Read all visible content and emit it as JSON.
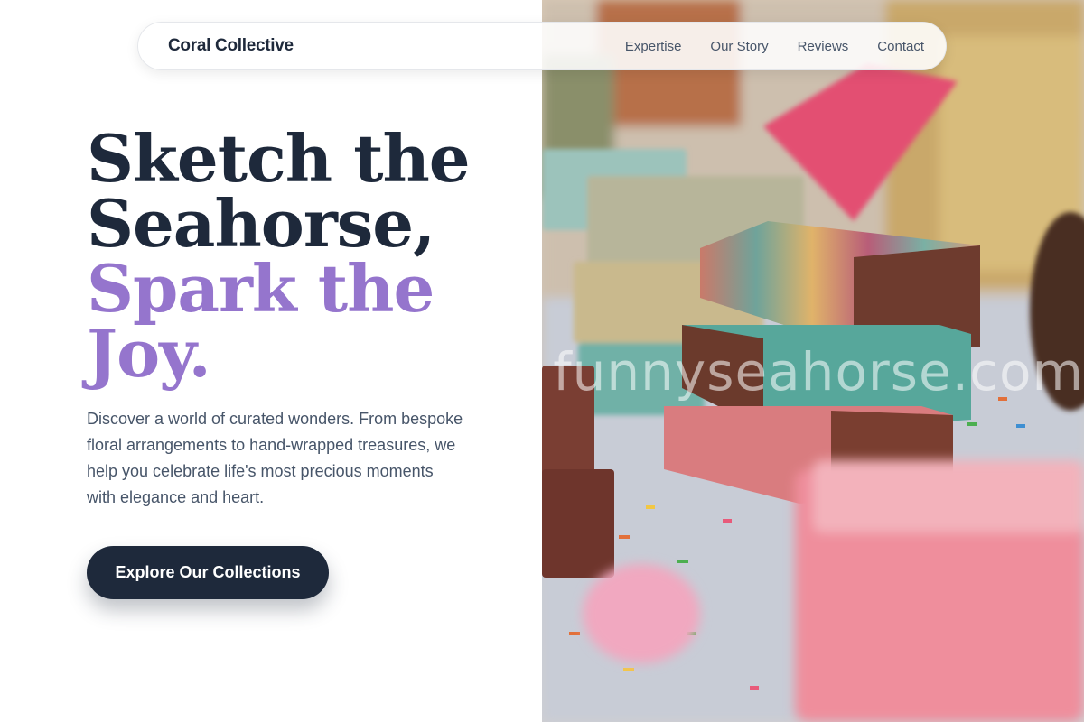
{
  "nav": {
    "brand": "Coral Collective",
    "links": [
      {
        "label": "Expertise"
      },
      {
        "label": "Our Story"
      },
      {
        "label": "Reviews"
      },
      {
        "label": "Contact"
      }
    ]
  },
  "hero": {
    "title_line1": "Sketch the",
    "title_line2": "Seahorse,",
    "title_line3": "Spark the",
    "title_line4": "Joy.",
    "description": "Discover a world of curated wonders. From bespoke floral arrangements to hand-wrapped treasures, we help you celebrate life's most precious moments with elegance and heart.",
    "cta_label": "Explore Our Collections"
  },
  "photo": {
    "watermark": "funnyseahorse.com"
  },
  "colors": {
    "dark": "#1e293b",
    "accent": "#9575cd",
    "muted": "#475569"
  }
}
